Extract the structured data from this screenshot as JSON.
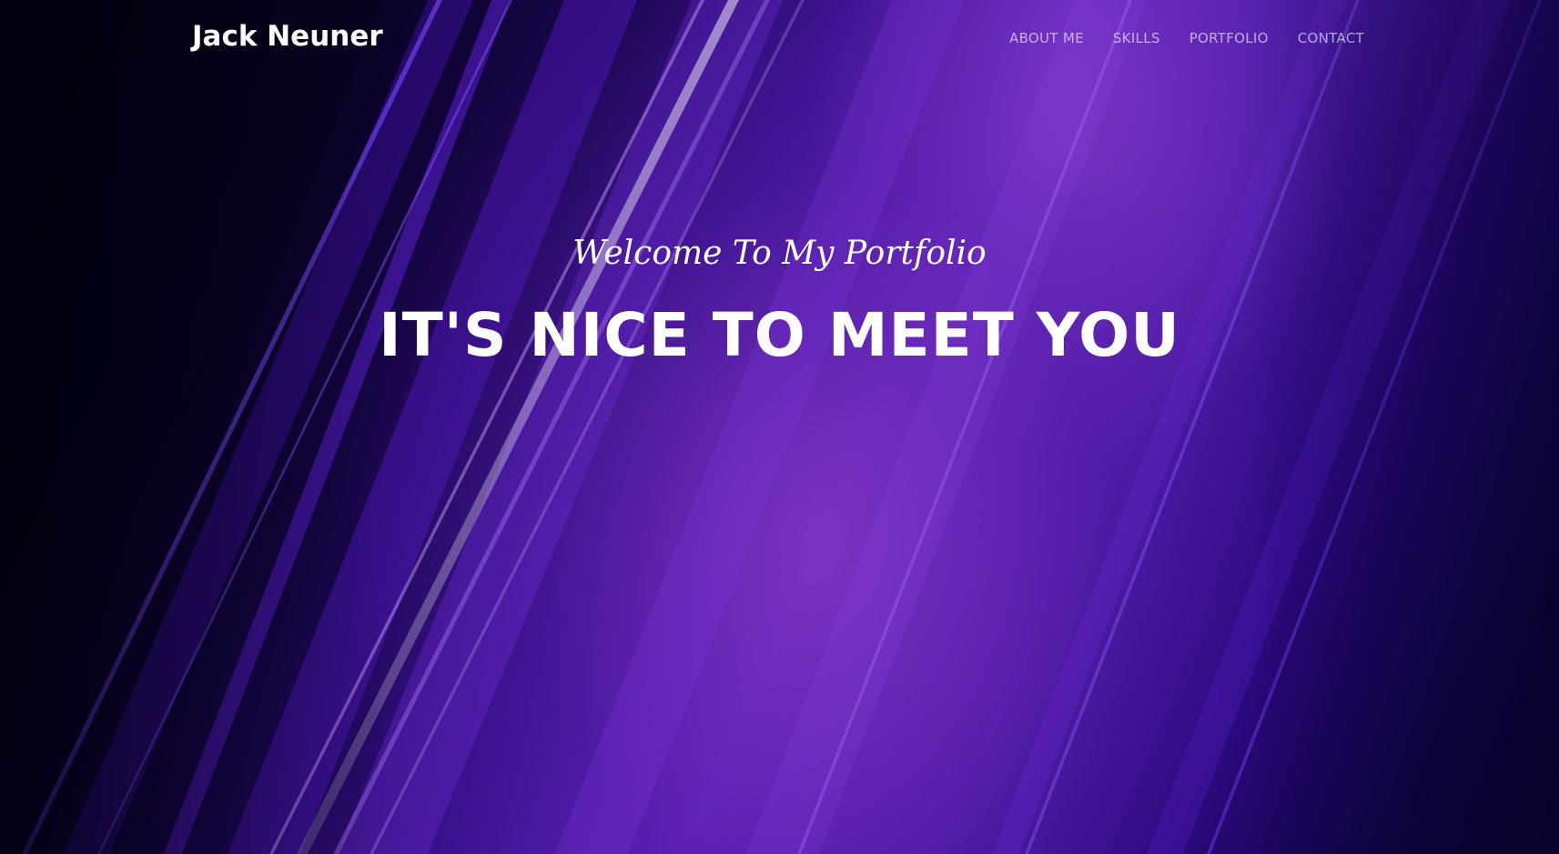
{
  "site": {
    "brand": "Jack Neuner"
  },
  "nav": {
    "items": [
      {
        "label": "ABOUT ME"
      },
      {
        "label": "SKILLS"
      },
      {
        "label": "PORTFOLIO"
      },
      {
        "label": "CONTACT"
      }
    ]
  },
  "hero": {
    "subheading": "Welcome To My Portfolio",
    "heading": "IT'S NICE TO MEET YOU",
    "background_theme": "purple light streaks",
    "accent_color": "#6a2bd0"
  }
}
